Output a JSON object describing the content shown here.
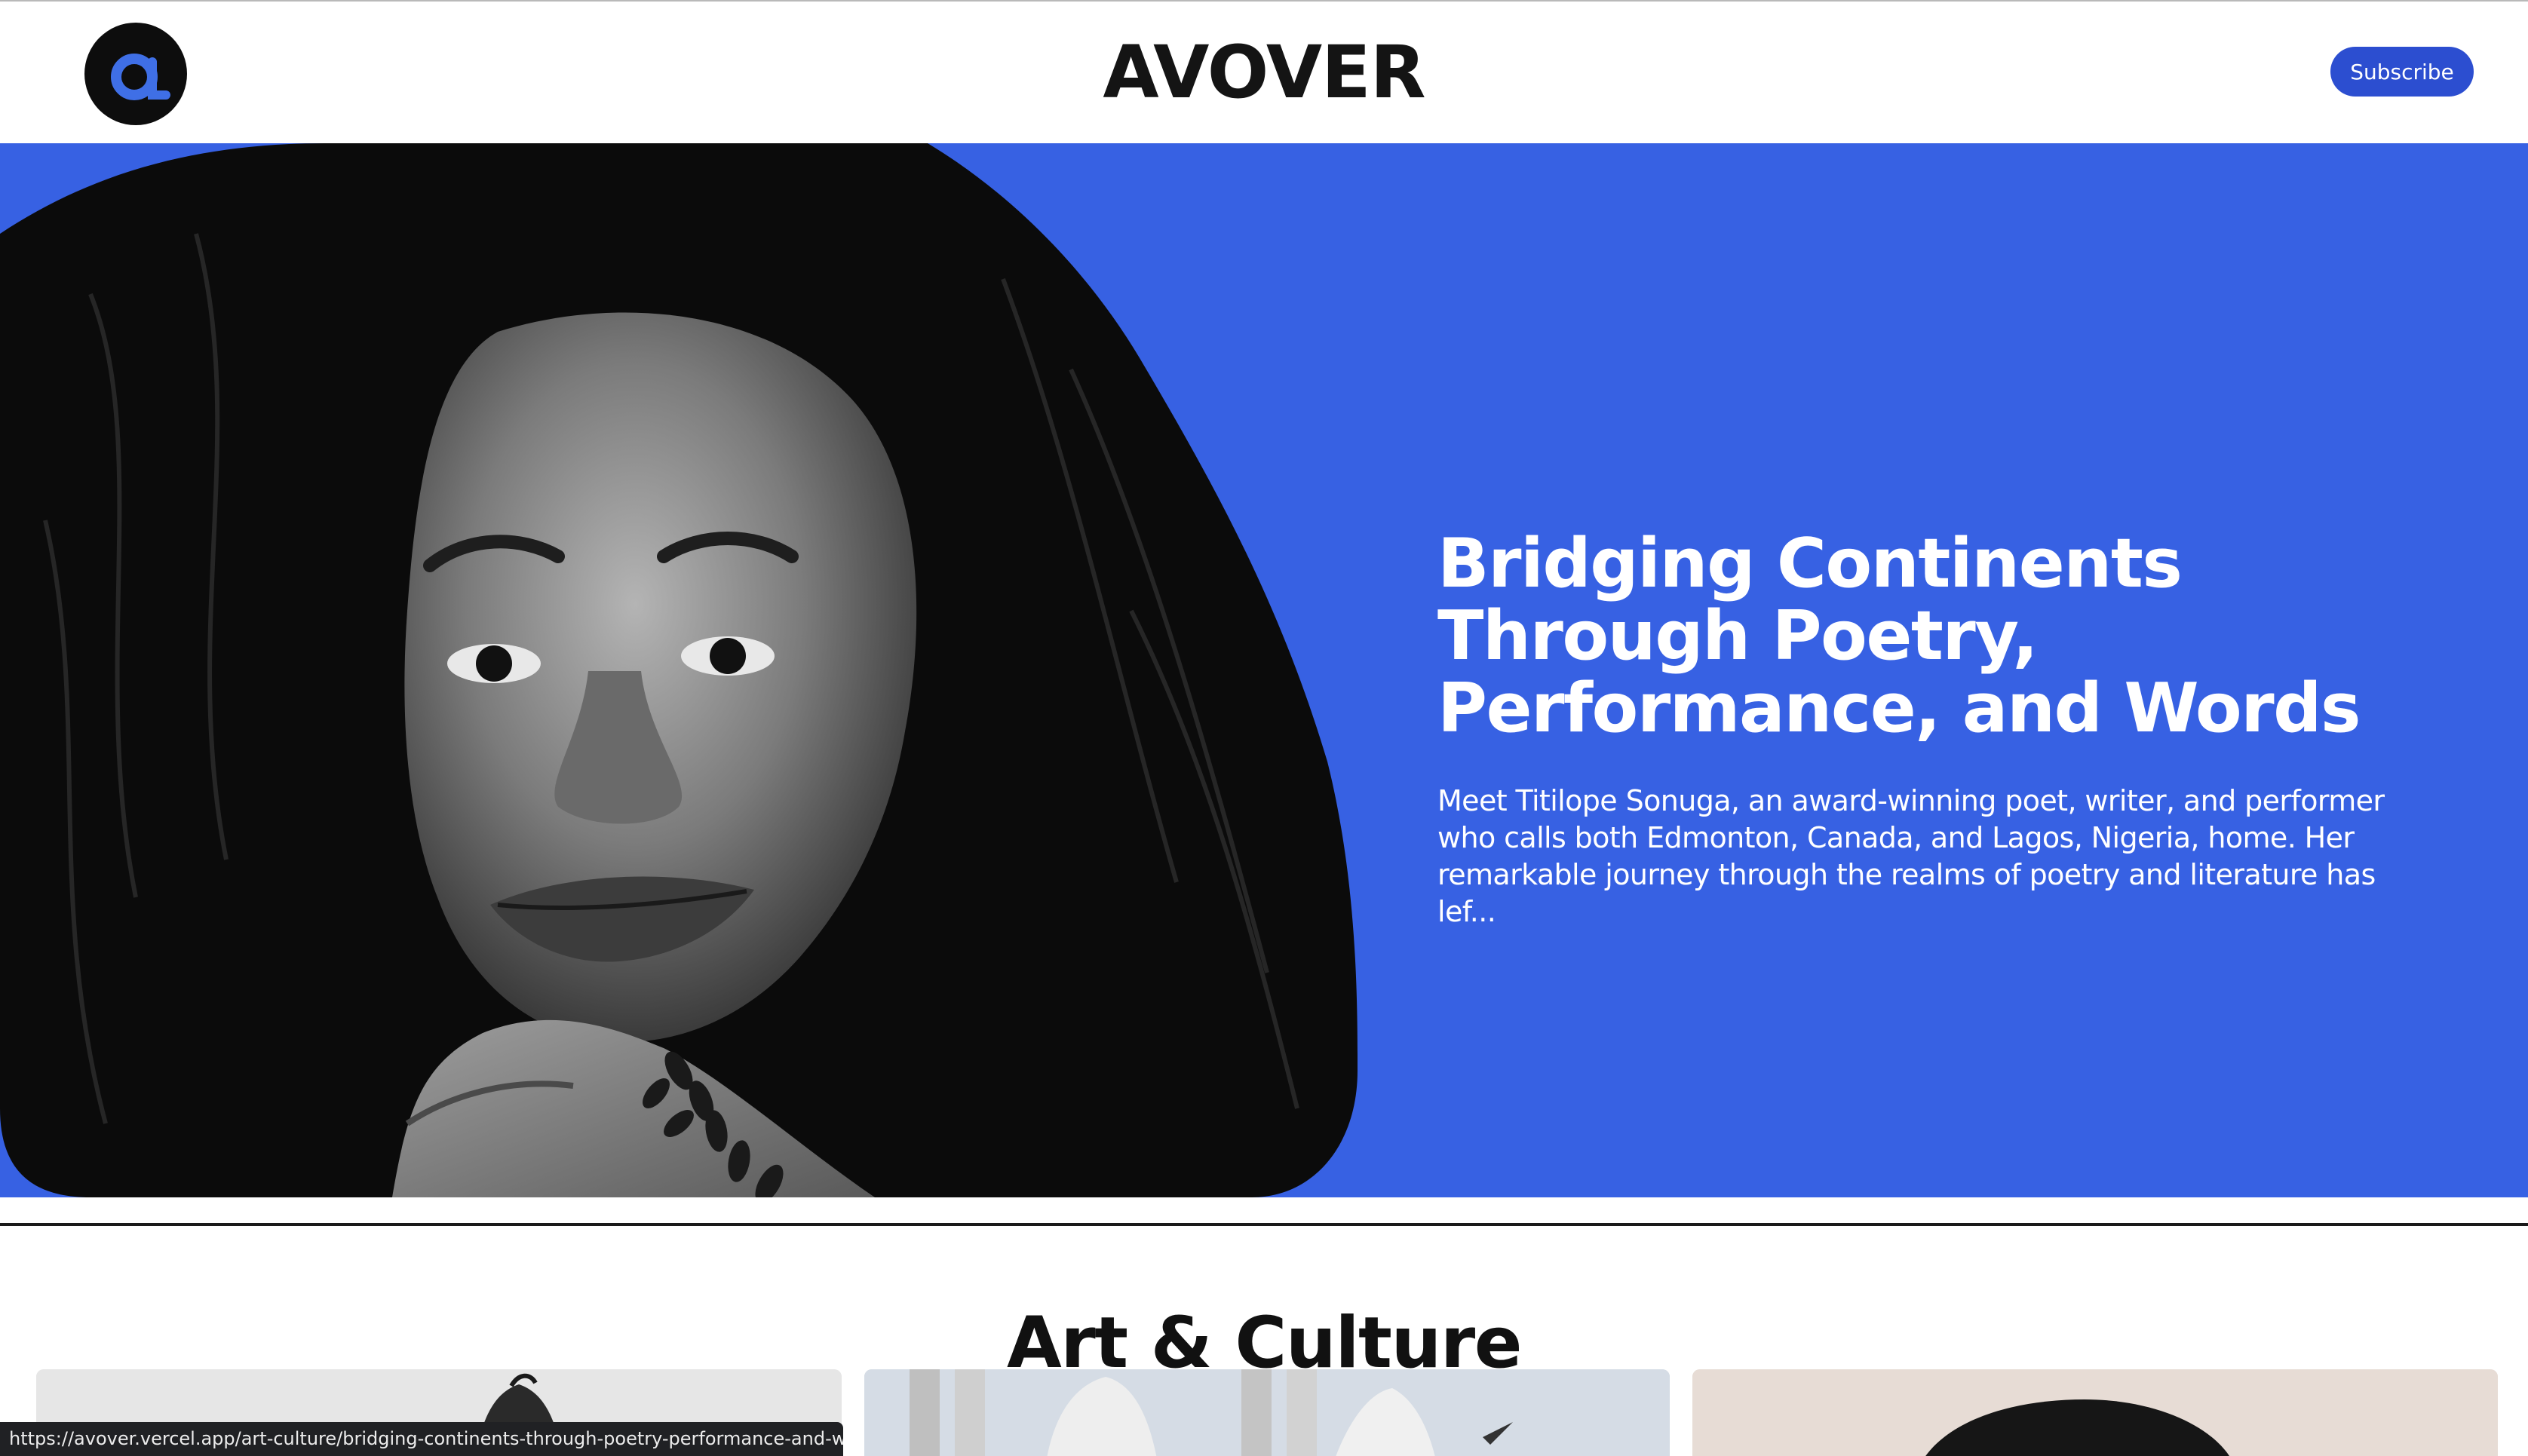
{
  "header": {
    "logo_icon": "avover-a-logo-icon",
    "brand": "AVOVER",
    "subscribe_label": "Subscribe"
  },
  "hero": {
    "image": "portrait-photo",
    "title": "Bridging Continents Through Poetry, Performance, and Words",
    "description": "Meet Titilope Sonuga, an award-winning poet, writer, and performer who calls both Edmonton, Canada, and Lagos, Nigeria, home. Her remarkable journey through the realms of poetry and literature has lef..."
  },
  "section": {
    "title": "Art & Culture",
    "cards": [
      {
        "image": "article-thumbnail-1"
      },
      {
        "image": "article-thumbnail-2"
      },
      {
        "image": "article-thumbnail-3"
      }
    ]
  },
  "status_bar": {
    "url": "https://avover.vercel.app/art-culture/bridging-continents-through-poetry-performance-and-w..."
  },
  "colors": {
    "accent": "#3761e3",
    "button": "#2c4ed0",
    "text": "#141414"
  }
}
